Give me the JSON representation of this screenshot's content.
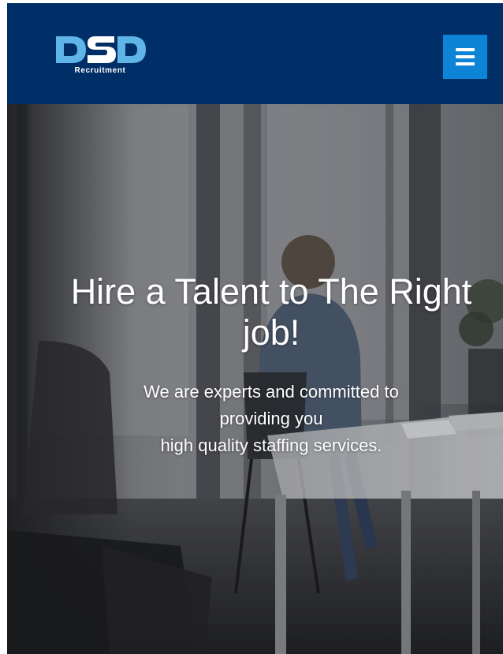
{
  "header": {
    "logo_text": "DSD",
    "logo_subtitle": "Recruitment",
    "menu_icon": "hamburger-menu-icon",
    "colors": {
      "background": "#002e66",
      "menu_button": "#0e84d6",
      "logo_light": "#5fb4e8",
      "logo_white": "#ffffff"
    }
  },
  "hero": {
    "title": "Hire a Talent to The Right job!",
    "text_lines": [
      "We are experts and committed to",
      "providing you",
      "high quality staffing services."
    ],
    "background_image": "office-meeting-room-photo"
  }
}
